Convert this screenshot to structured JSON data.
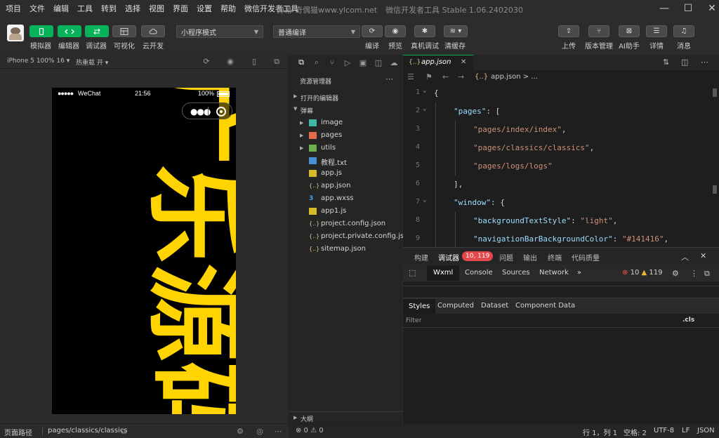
{
  "menu": [
    "项目",
    "文件",
    "编辑",
    "工具",
    "转到",
    "选择",
    "视图",
    "界面",
    "设置",
    "帮助",
    "微信开发者工具"
  ],
  "window_title": {
    "project": "弹幕-奇偶猫www.ylcom.net",
    "app": "微信开发者工具 Stable 1.06.2402030"
  },
  "toolbar": {
    "simulator": "模拟器",
    "editor": "编辑器",
    "debugger": "调试器",
    "visual": "可视化",
    "cloud": "云开发",
    "mode_select": "小程序模式",
    "compile_select": "普通编译",
    "compile": "编译",
    "preview": "预览",
    "real_debug": "真机调试",
    "clear_cache": "清缓存",
    "upload": "上传",
    "version": "版本管理",
    "ai": "AI助手",
    "details": "详情",
    "messages": "消息"
  },
  "simulator": {
    "device": "iPhone 5 100% 16 ▾",
    "hot_reload": "热重载 开 ▾",
    "status": {
      "signal": "●●●●●",
      "carrier": "WeChat",
      "time": "21:56",
      "battery": "100%"
    },
    "danmu_text": "广乐源码"
  },
  "sim_footer": {
    "label": "页面路径",
    "path": "pages/classics/classics"
  },
  "explorer": {
    "title": "资源管理器",
    "open_editors": "打开的编辑器",
    "project": "弹幕",
    "files": [
      {
        "name": "image",
        "type": "folder",
        "color": "#3fb9a6"
      },
      {
        "name": "pages",
        "type": "folder",
        "color": "#e06c4a"
      },
      {
        "name": "utils",
        "type": "folder",
        "color": "#6ab04c"
      },
      {
        "name": "教程.txt",
        "type": "txt"
      },
      {
        "name": "app.js",
        "type": "js"
      },
      {
        "name": "app.json",
        "type": "json"
      },
      {
        "name": "app.wxss",
        "type": "wxss"
      },
      {
        "name": "app1.js",
        "type": "js"
      },
      {
        "name": "project.config.json",
        "type": "json"
      },
      {
        "name": "project.private.config.js...",
        "type": "json"
      },
      {
        "name": "sitemap.json",
        "type": "json"
      }
    ],
    "outline": "大纲",
    "footer": "⊗ 0 ⚠ 0"
  },
  "editor": {
    "tab": "app.json",
    "breadcrumb": "app.json > ...",
    "lines": [
      {
        "n": "1",
        "indent": 0,
        "parts": [
          [
            "pun",
            "{"
          ]
        ],
        "fold": true
      },
      {
        "n": "2",
        "indent": 1,
        "parts": [
          [
            "key",
            "\"pages\""
          ],
          [
            "pun",
            ": ["
          ]
        ],
        "fold": true
      },
      {
        "n": "3",
        "indent": 2,
        "parts": [
          [
            "str",
            "\"pages/index/index\""
          ],
          [
            "pun",
            ","
          ]
        ]
      },
      {
        "n": "4",
        "indent": 2,
        "parts": [
          [
            "str",
            "\"pages/classics/classics\""
          ],
          [
            "pun",
            ","
          ]
        ]
      },
      {
        "n": "5",
        "indent": 2,
        "parts": [
          [
            "str",
            "\"pages/logs/logs\""
          ]
        ]
      },
      {
        "n": "6",
        "indent": 1,
        "parts": [
          [
            "pun",
            "],"
          ]
        ]
      },
      {
        "n": "7",
        "indent": 1,
        "parts": [
          [
            "key",
            "\"window\""
          ],
          [
            "pun",
            ": {"
          ]
        ],
        "fold": true
      },
      {
        "n": "8",
        "indent": 2,
        "parts": [
          [
            "key",
            "\"backgroundTextStyle\""
          ],
          [
            "pun",
            ": "
          ],
          [
            "str",
            "\"light\""
          ],
          [
            "pun",
            ","
          ]
        ]
      },
      {
        "n": "9",
        "indent": 2,
        "parts": [
          [
            "key",
            "\"navigationBarBackgroundColor\""
          ],
          [
            "pun",
            ": "
          ],
          [
            "str",
            "\"#141416\""
          ],
          [
            "pun",
            ","
          ]
        ]
      }
    ]
  },
  "debug": {
    "tabs": {
      "build": "构建",
      "debugger": "调试器",
      "badge": "10, 119",
      "issues": "问题",
      "output": "输出",
      "terminal": "终端",
      "quality": "代码质量"
    },
    "devtools": {
      "wxml": "Wxml",
      "console": "Console",
      "sources": "Sources",
      "network": "Network",
      "more": "»"
    },
    "errors": "10",
    "warnings": "119",
    "styles_tabs": [
      "Styles",
      "Computed",
      "Dataset",
      "Component Data"
    ],
    "filter_placeholder": "Filter",
    "cls": ".cls"
  },
  "statusbar": {
    "position": "行 1，列 1",
    "spaces": "空格: 2",
    "encoding": "UTF-8",
    "eol": "LF",
    "language": "JSON"
  },
  "colors": {
    "accent": "#07b35a",
    "danmu": "#ffd400",
    "badge": "#e0484b"
  }
}
